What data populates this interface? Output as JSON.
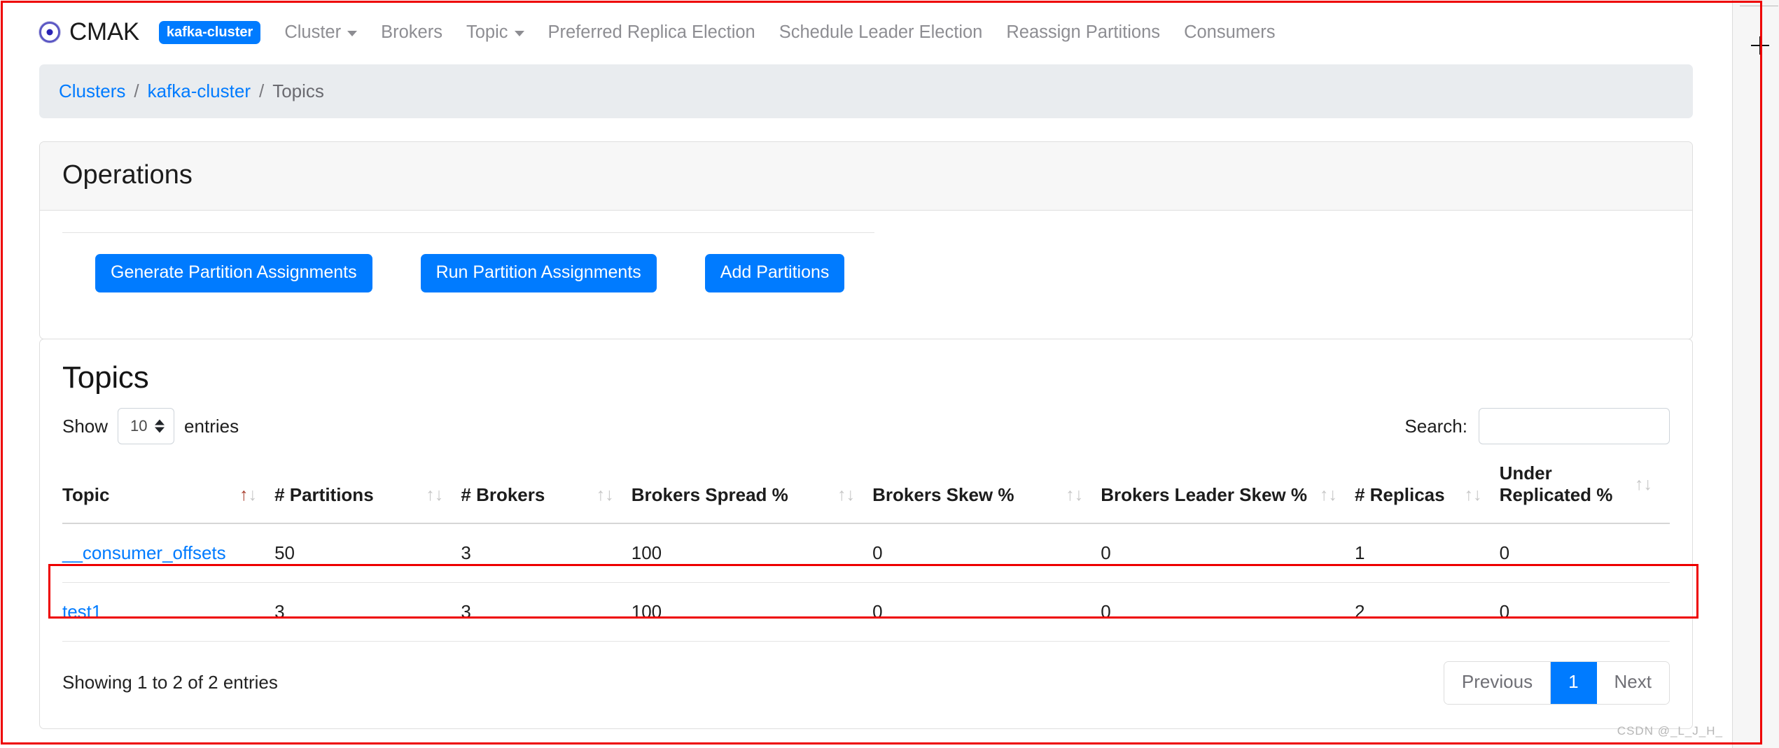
{
  "navbar": {
    "brand": "CMAK",
    "brand_logo_icon": "bullseye-icon",
    "cluster_badge": "kafka-cluster",
    "items": [
      {
        "label": "Cluster",
        "has_caret": true
      },
      {
        "label": "Brokers",
        "has_caret": false
      },
      {
        "label": "Topic",
        "has_caret": true
      },
      {
        "label": "Preferred Replica Election",
        "has_caret": false
      },
      {
        "label": "Schedule Leader Election",
        "has_caret": false
      },
      {
        "label": "Reassign Partitions",
        "has_caret": false
      },
      {
        "label": "Consumers",
        "has_caret": false
      }
    ]
  },
  "breadcrumb": {
    "item1": "Clusters",
    "sep1": "/",
    "item2": "kafka-cluster",
    "sep2": "/",
    "item3": "Topics"
  },
  "operations": {
    "title": "Operations",
    "buttons": [
      "Generate Partition Assignments",
      "Run Partition Assignments",
      "Add Partitions"
    ]
  },
  "topics": {
    "title": "Topics",
    "show_label": "Show",
    "entries_label": "entries",
    "page_length": "10",
    "search_label": "Search:",
    "search_value": "",
    "search_placeholder": "",
    "columns": [
      "Topic",
      "# Partitions",
      "# Brokers",
      "Brokers Spread %",
      "Brokers Skew %",
      "Brokers Leader Skew %",
      "# Replicas",
      "Under Replicated %"
    ],
    "sorted_column_index": 0,
    "sort_direction": "asc",
    "rows": [
      {
        "topic": "__consumer_offsets",
        "partitions": "50",
        "brokers": "3",
        "brokers_spread": "100",
        "brokers_skew": "0",
        "brokers_leader_skew": "0",
        "replicas": "1",
        "under_replicated": "0"
      },
      {
        "topic": "test1",
        "partitions": "3",
        "brokers": "3",
        "brokers_spread": "100",
        "brokers_skew": "0",
        "brokers_leader_skew": "0",
        "replicas": "2",
        "under_replicated": "0"
      }
    ],
    "info": "Showing 1 to 2 of 2 entries",
    "pagination": {
      "previous": "Previous",
      "pages": [
        "1"
      ],
      "next": "Next",
      "active_page": "1"
    }
  },
  "watermark": "CSDN @_L_J_H_",
  "colors": {
    "primary": "#007bff",
    "badge": "#007bff",
    "link": "#007bff",
    "annotation": "#ee0000",
    "breadcrumb_bg": "#e9ecef",
    "card_header_bg": "#f7f7f7"
  }
}
